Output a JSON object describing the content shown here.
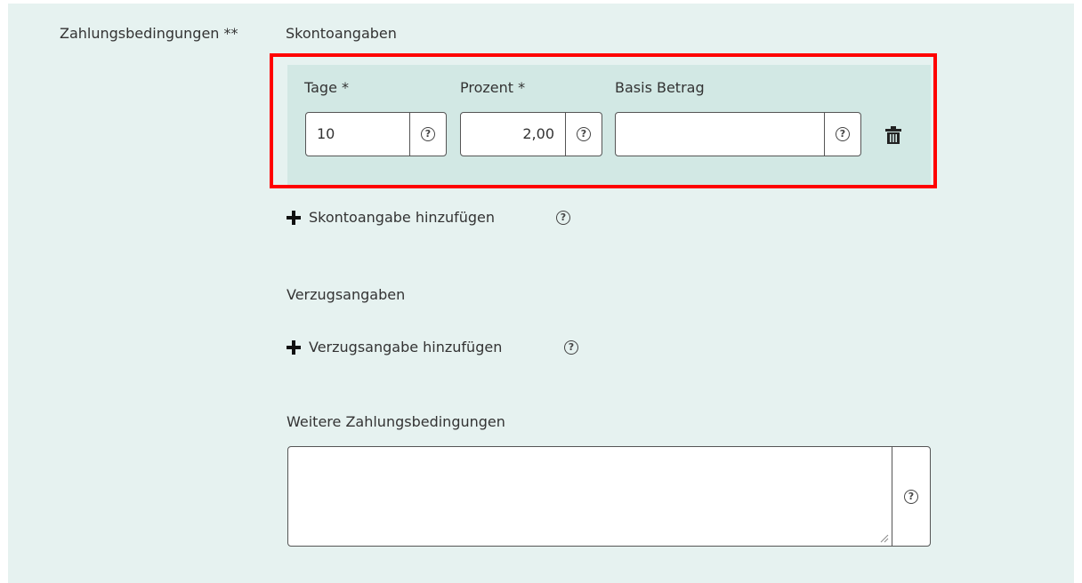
{
  "form": {
    "section_label": "Zahlungsbedingungen **",
    "skonto": {
      "heading": "Skontoangaben",
      "columns": {
        "tage": "Tage *",
        "prozent": "Prozent *",
        "basis": "Basis Betrag"
      },
      "entry": {
        "tage_value": "10",
        "prozent_value": "2,00",
        "basis_value": ""
      },
      "add_label": "Skontoangabe hinzufügen"
    },
    "verzug": {
      "heading": "Verzugsangaben",
      "add_label": "Verzugsangabe hinzufügen"
    },
    "weitere": {
      "heading": "Weitere Zahlungsbedingungen",
      "value": ""
    }
  },
  "icons": {
    "help": "help-circle-icon",
    "delete": "trash-icon",
    "add": "plus-icon",
    "resize": "resize-grip-icon"
  },
  "colors": {
    "panel_background": "#e6f2f0",
    "entry_background": "#d2e8e4",
    "highlight_border": "#ff0000"
  }
}
